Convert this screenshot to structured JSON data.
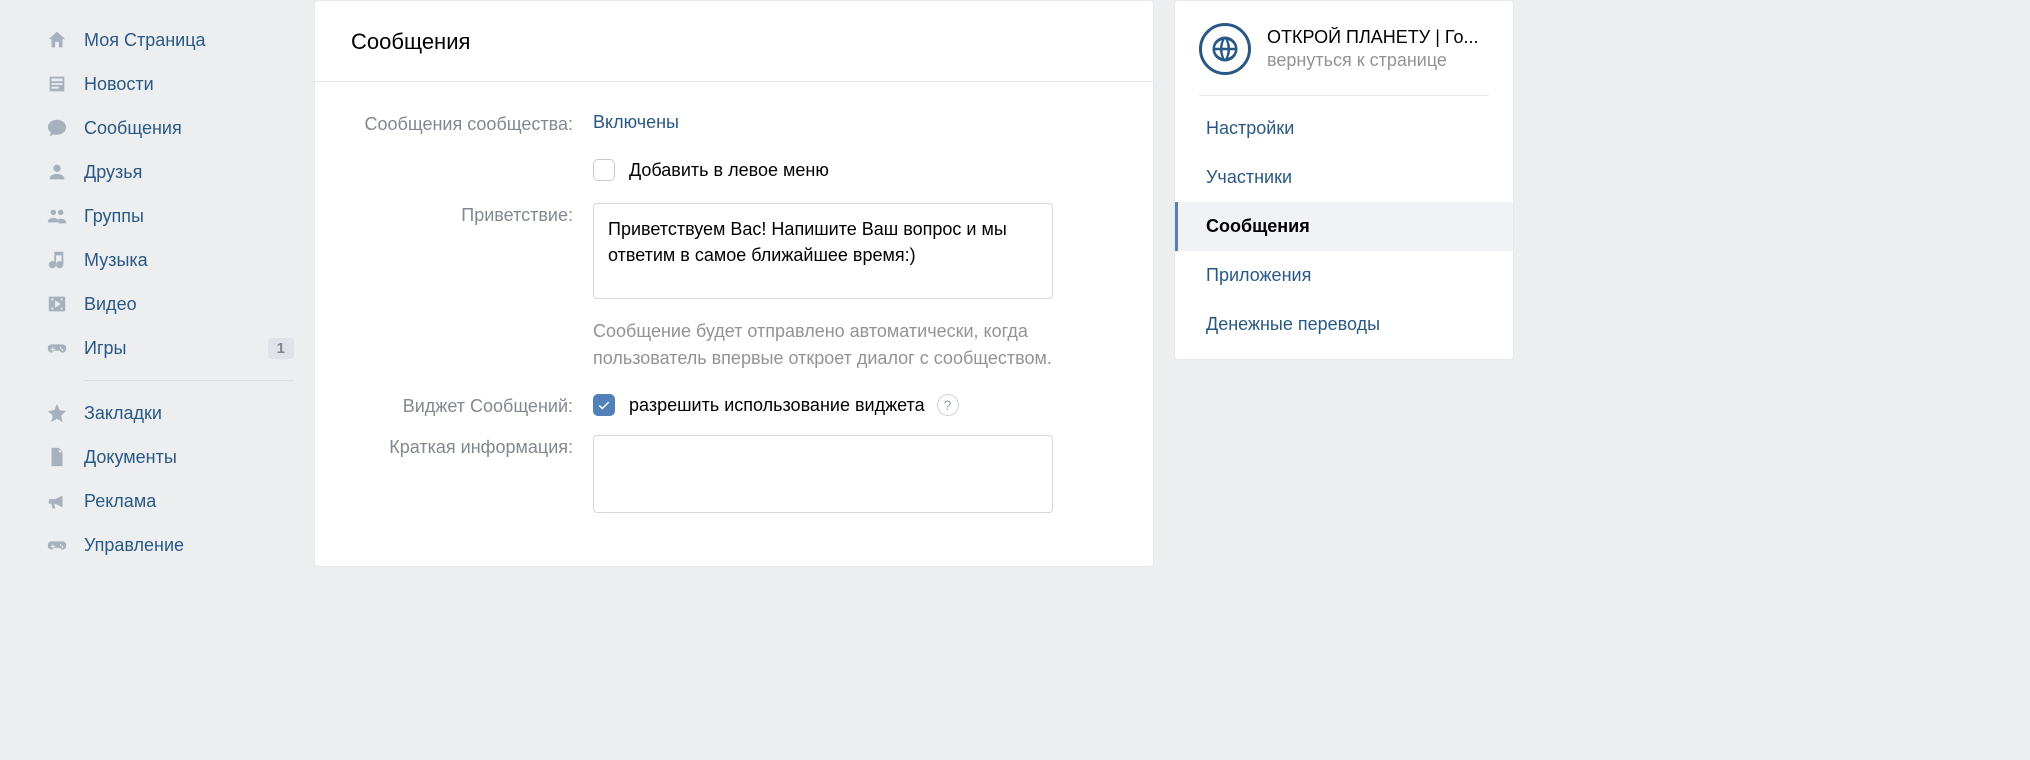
{
  "leftNav": {
    "items": [
      {
        "id": "my-page",
        "label": "Моя Страница"
      },
      {
        "id": "news",
        "label": "Новости"
      },
      {
        "id": "messages",
        "label": "Сообщения"
      },
      {
        "id": "friends",
        "label": "Друзья"
      },
      {
        "id": "groups",
        "label": "Группы"
      },
      {
        "id": "music",
        "label": "Музыка"
      },
      {
        "id": "video",
        "label": "Видео"
      },
      {
        "id": "games",
        "label": "Игры",
        "badge": "1"
      }
    ],
    "secondary": [
      {
        "id": "bookmarks",
        "label": "Закладки"
      },
      {
        "id": "documents",
        "label": "Документы"
      },
      {
        "id": "ads",
        "label": "Реклама"
      },
      {
        "id": "manage",
        "label": "Управление"
      }
    ]
  },
  "main": {
    "title": "Сообщения",
    "communityMessagesLabel": "Сообщения сообщества:",
    "communityMessagesStatus": "Включены",
    "addToLeftMenuLabel": "Добавить в левое меню",
    "addToLeftMenuChecked": false,
    "greetingLabel": "Приветствие:",
    "greetingValue": "Приветствуем Вас! Напишите Ваш вопрос и мы ответим в самое ближайшее время:)",
    "greetingHint": "Сообщение будет отправлено автоматически, когда пользователь впервые откроет диалог с сообществом.",
    "widgetLabel": "Виджет Сообщений:",
    "widgetAllowLabel": "разрешить использование виджета",
    "widgetAllowChecked": true,
    "shortInfoLabel": "Краткая информация:",
    "shortInfoValue": ""
  },
  "right": {
    "groupTitle": "ОТКРОЙ ПЛАНЕТУ | Го...",
    "groupSubtitle": "вернуться к странице",
    "menu": [
      {
        "id": "settings",
        "label": "Настройки"
      },
      {
        "id": "members",
        "label": "Участники"
      },
      {
        "id": "messages",
        "label": "Сообщения",
        "active": true
      },
      {
        "id": "apps",
        "label": "Приложения"
      },
      {
        "id": "payments",
        "label": "Денежные переводы"
      }
    ]
  }
}
